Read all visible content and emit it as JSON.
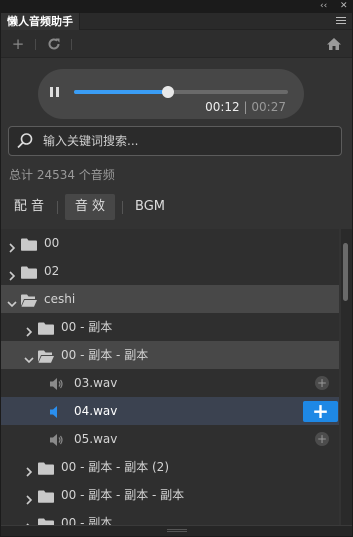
{
  "window": {
    "collapse_glyph": "‹‹",
    "close_glyph": "✕",
    "tab_title": "懒人音频助手",
    "menu_icon": "hamburger-menu-icon"
  },
  "toolbar": {
    "add_glyph": "+",
    "refresh_icon": "refresh-icon",
    "home_icon": "home-icon"
  },
  "player": {
    "state": "playing",
    "progress_fraction": 0.44,
    "current_time": "00:12",
    "separator": "|",
    "duration": "00:27",
    "accent_color": "#3a9df5"
  },
  "search": {
    "placeholder": "输入关键词搜索...",
    "value": ""
  },
  "summary": {
    "total_text": "总计 24534 个音频"
  },
  "categories": [
    {
      "label": "配 音",
      "active": false
    },
    {
      "label": "音 效",
      "active": true
    },
    {
      "label": "BGM",
      "active": false
    }
  ],
  "tree": [
    {
      "label": "00",
      "type": "folder",
      "expanded": false,
      "level": 0
    },
    {
      "label": "02",
      "type": "folder",
      "expanded": false,
      "level": 0
    },
    {
      "label": "ceshi",
      "type": "folder",
      "expanded": true,
      "level": 0
    },
    {
      "label": "00 - 副本",
      "type": "folder",
      "expanded": false,
      "level": 1
    },
    {
      "label": "00 - 副本 - 副本",
      "type": "folder",
      "expanded": true,
      "level": 1
    },
    {
      "label": "03.wav",
      "type": "file",
      "level": 2
    },
    {
      "label": "04.wav",
      "type": "file",
      "level": 2,
      "playing": true
    },
    {
      "label": "05.wav",
      "type": "file",
      "level": 2
    },
    {
      "label": "00 - 副本 - 副本 (2)",
      "type": "folder",
      "expanded": false,
      "level": 1
    },
    {
      "label": "00 - 副本 - 副本 - 副本",
      "type": "folder",
      "expanded": false,
      "level": 1
    },
    {
      "label": "00 - 副本",
      "type": "folder",
      "expanded": false,
      "level": 1
    }
  ],
  "add_glyph": "+"
}
